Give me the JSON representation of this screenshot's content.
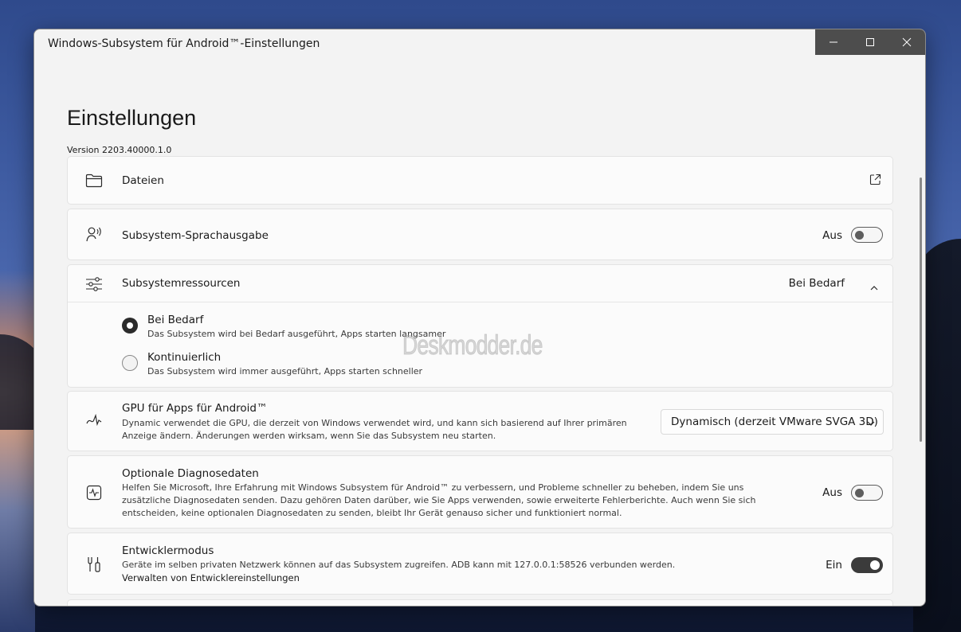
{
  "window": {
    "title": "Windows-Subsystem für Android™-Einstellungen"
  },
  "caption_buttons": [
    "minimize",
    "maximize",
    "close"
  ],
  "page": {
    "title": "Einstellungen",
    "version": "Version 2203.40000.1.0"
  },
  "watermark": "Deskmodder.de",
  "settings": {
    "files": {
      "label": "Dateien",
      "icon": "folder-icon",
      "action_icon": "open-external-icon"
    },
    "speech": {
      "label": "Subsystem-Sprachausgabe",
      "icon": "speech-icon",
      "state": "Aus",
      "enabled": false
    },
    "resources": {
      "label": "Subsystemressourcen",
      "icon": "sliders-icon",
      "value": "Bei Bedarf",
      "expanded": true,
      "options": [
        {
          "label": "Bei Bedarf",
          "desc": "Das Subsystem wird bei Bedarf ausgeführt, Apps starten langsamer",
          "selected": true
        },
        {
          "label": "Kontinuierlich",
          "desc": "Das Subsystem wird immer ausgeführt, Apps starten schneller",
          "selected": false
        }
      ]
    },
    "gpu": {
      "label": "GPU für Apps für Android™",
      "icon": "gpu-icon",
      "desc_line1": "Dynamic verwendet die GPU, die derzeit von Windows verwendet wird, und kann sich basierend auf Ihrer primären",
      "desc_line2": "Anzeige ändern. Änderungen werden wirksam, wenn Sie das Subsystem neu starten.",
      "selected": "Dynamisch (derzeit VMware SVGA 3D)"
    },
    "diagnostics": {
      "label": "Optionale Diagnosedaten",
      "icon": "pulse-icon",
      "desc_line1": "Helfen Sie Microsoft, Ihre Erfahrung mit Windows Subsystem für Android™ zu verbessern, und Probleme schneller zu beheben, indem Sie uns",
      "desc_line2": "zusätzliche Diagnosedaten senden. Dazu gehören Daten darüber, wie Sie Apps verwenden, sowie erweiterte Fehlerberichte. Auch wenn Sie sich",
      "desc_line3": "entscheiden, keine optionalen Diagnosedaten zu senden, bleibt Ihr Gerät genauso sicher und funktioniert normal.",
      "state": "Aus",
      "enabled": false
    },
    "developer": {
      "label": "Entwicklermodus",
      "icon": "developer-tools-icon",
      "desc": "Geräte im selben privaten Netzwerk können auf das Subsystem zugreifen. ADB kann mit 127.0.0.1:58526 verbunden werden.",
      "link": "Verwalten von Entwicklereinstellungen",
      "state": "Ein",
      "enabled": true
    }
  }
}
